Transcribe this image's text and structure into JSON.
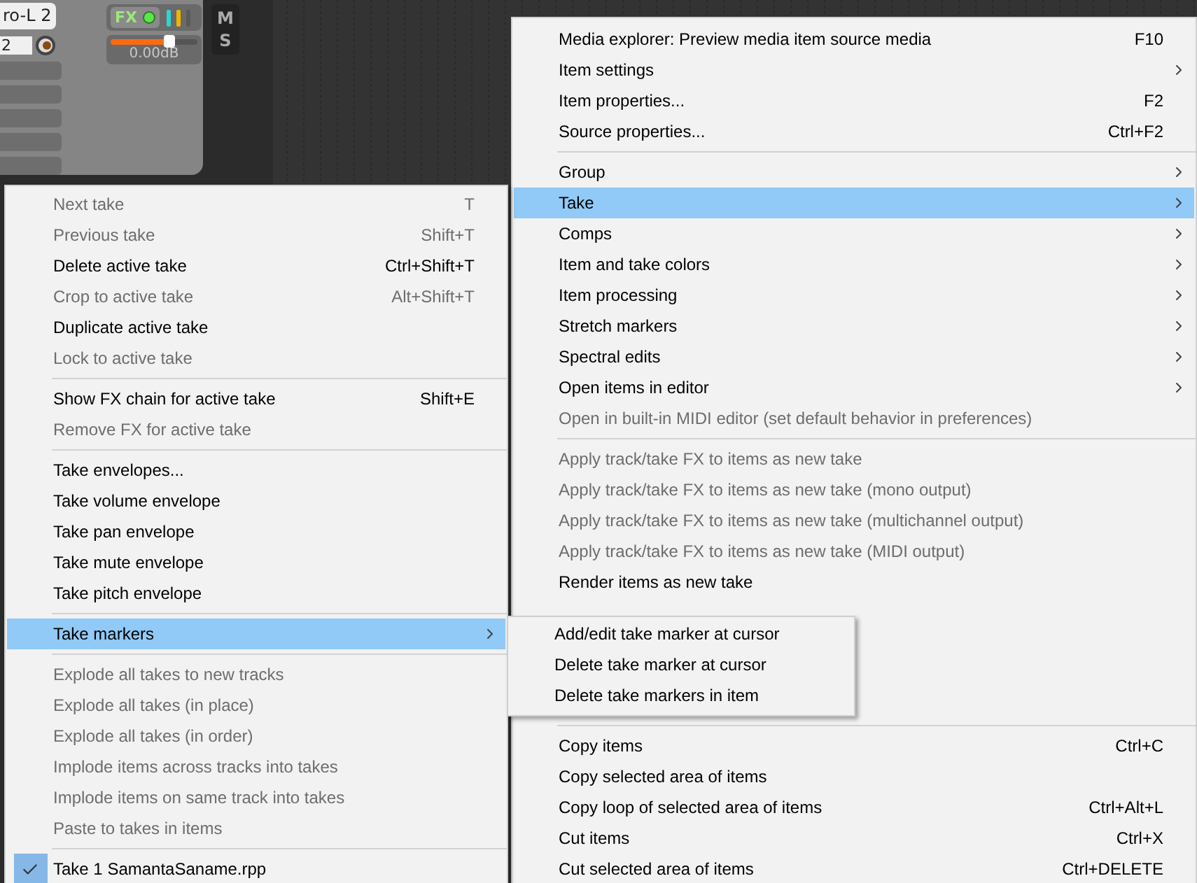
{
  "track_panel": {
    "name_field": "ro-L 2",
    "input_field": "2",
    "fx_button": "FX",
    "fader": {
      "level": 0.68,
      "reading": "0.00dB"
    },
    "mute_button": "M",
    "solo_button": "S"
  },
  "context_menu": {
    "items": [
      {
        "kind": "item",
        "label": "Media explorer: Preview media item source media",
        "shortcut": "F10",
        "disabled": false,
        "submenu": false,
        "selected": false
      },
      {
        "kind": "item",
        "label": "Item settings",
        "disabled": false,
        "submenu": true,
        "selected": false
      },
      {
        "kind": "item",
        "label": "Item properties...",
        "shortcut": "F2",
        "disabled": false,
        "submenu": false,
        "selected": false
      },
      {
        "kind": "item",
        "label": "Source properties...",
        "shortcut": "Ctrl+F2",
        "disabled": false,
        "submenu": false,
        "selected": false
      },
      {
        "kind": "separator"
      },
      {
        "kind": "item",
        "label": "Group",
        "disabled": false,
        "submenu": true,
        "selected": false
      },
      {
        "kind": "item",
        "label": "Take",
        "disabled": false,
        "submenu": true,
        "selected": true
      },
      {
        "kind": "item",
        "label": "Comps",
        "disabled": false,
        "submenu": true,
        "selected": false
      },
      {
        "kind": "item",
        "label": "Item and take colors",
        "disabled": false,
        "submenu": true,
        "selected": false
      },
      {
        "kind": "item",
        "label": "Item processing",
        "disabled": false,
        "submenu": true,
        "selected": false
      },
      {
        "kind": "item",
        "label": "Stretch markers",
        "disabled": false,
        "submenu": true,
        "selected": false
      },
      {
        "kind": "item",
        "label": "Spectral edits",
        "disabled": false,
        "submenu": true,
        "selected": false
      },
      {
        "kind": "item",
        "label": "Open items in editor",
        "disabled": false,
        "submenu": true,
        "selected": false
      },
      {
        "kind": "item",
        "label": "Open in built-in MIDI editor (set default behavior in preferences)",
        "disabled": true,
        "submenu": false,
        "selected": false
      },
      {
        "kind": "separator"
      },
      {
        "kind": "item",
        "label": "Apply track/take FX to items as new take",
        "disabled": true,
        "submenu": false,
        "selected": false
      },
      {
        "kind": "item",
        "label": "Apply track/take FX to items as new take (mono output)",
        "disabled": true,
        "submenu": false,
        "selected": false
      },
      {
        "kind": "item",
        "label": "Apply track/take FX to items as new take (multichannel output)",
        "disabled": true,
        "submenu": false,
        "selected": false
      },
      {
        "kind": "item",
        "label": "Apply track/take FX to items as new take (MIDI output)",
        "disabled": true,
        "submenu": false,
        "selected": false
      },
      {
        "kind": "item",
        "label": "Render items as new take",
        "disabled": false,
        "submenu": false,
        "selected": false
      },
      {
        "kind": "covered"
      },
      {
        "kind": "covered"
      },
      {
        "kind": "covered"
      },
      {
        "kind": "covered"
      },
      {
        "kind": "separator"
      },
      {
        "kind": "item",
        "label": "Copy items",
        "shortcut": "Ctrl+C",
        "disabled": false,
        "submenu": false,
        "selected": false
      },
      {
        "kind": "item",
        "label": "Copy selected area of items",
        "disabled": false,
        "submenu": false,
        "selected": false
      },
      {
        "kind": "item",
        "label": "Copy loop of selected area of items",
        "shortcut": "Ctrl+Alt+L",
        "disabled": false,
        "submenu": false,
        "selected": false
      },
      {
        "kind": "item",
        "label": "Cut items",
        "shortcut": "Ctrl+X",
        "disabled": false,
        "submenu": false,
        "selected": false
      },
      {
        "kind": "item",
        "label": "Cut selected area of items",
        "shortcut": "Ctrl+DELETE",
        "disabled": false,
        "submenu": false,
        "selected": false
      }
    ]
  },
  "take_submenu": {
    "items": [
      {
        "kind": "item",
        "label": "Next take",
        "shortcut": "T",
        "disabled": true,
        "submenu": false,
        "selected": false,
        "checked": false
      },
      {
        "kind": "item",
        "label": "Previous take",
        "shortcut": "Shift+T",
        "disabled": true,
        "submenu": false,
        "selected": false,
        "checked": false
      },
      {
        "kind": "item",
        "label": "Delete active take",
        "shortcut": "Ctrl+Shift+T",
        "disabled": false,
        "submenu": false,
        "selected": false,
        "checked": false
      },
      {
        "kind": "item",
        "label": "Crop to active take",
        "shortcut": "Alt+Shift+T",
        "disabled": true,
        "submenu": false,
        "selected": false,
        "checked": false
      },
      {
        "kind": "item",
        "label": "Duplicate active take",
        "disabled": false,
        "submenu": false,
        "selected": false,
        "checked": false
      },
      {
        "kind": "item",
        "label": "Lock to active take",
        "disabled": true,
        "submenu": false,
        "selected": false,
        "checked": false
      },
      {
        "kind": "separator"
      },
      {
        "kind": "item",
        "label": "Show FX chain for active take",
        "shortcut": "Shift+E",
        "disabled": false,
        "submenu": false,
        "selected": false,
        "checked": false
      },
      {
        "kind": "item",
        "label": "Remove FX for active take",
        "disabled": true,
        "submenu": false,
        "selected": false,
        "checked": false
      },
      {
        "kind": "separator"
      },
      {
        "kind": "item",
        "label": "Take envelopes...",
        "disabled": false,
        "submenu": false,
        "selected": false,
        "checked": false
      },
      {
        "kind": "item",
        "label": "Take volume envelope",
        "disabled": false,
        "submenu": false,
        "selected": false,
        "checked": false
      },
      {
        "kind": "item",
        "label": "Take pan envelope",
        "disabled": false,
        "submenu": false,
        "selected": false,
        "checked": false
      },
      {
        "kind": "item",
        "label": "Take mute envelope",
        "disabled": false,
        "submenu": false,
        "selected": false,
        "checked": false
      },
      {
        "kind": "item",
        "label": "Take pitch envelope",
        "disabled": false,
        "submenu": false,
        "selected": false,
        "checked": false
      },
      {
        "kind": "separator"
      },
      {
        "kind": "item",
        "label": "Take markers",
        "disabled": false,
        "submenu": true,
        "selected": true,
        "checked": false
      },
      {
        "kind": "separator"
      },
      {
        "kind": "item",
        "label": "Explode all takes to new tracks",
        "disabled": true,
        "submenu": false,
        "selected": false,
        "checked": false
      },
      {
        "kind": "item",
        "label": "Explode all takes (in place)",
        "disabled": true,
        "submenu": false,
        "selected": false,
        "checked": false
      },
      {
        "kind": "item",
        "label": "Explode all takes (in order)",
        "disabled": true,
        "submenu": false,
        "selected": false,
        "checked": false
      },
      {
        "kind": "item",
        "label": "Implode items across tracks into takes",
        "disabled": true,
        "submenu": false,
        "selected": false,
        "checked": false
      },
      {
        "kind": "item",
        "label": "Implode items on same track into takes",
        "disabled": true,
        "submenu": false,
        "selected": false,
        "checked": false
      },
      {
        "kind": "item",
        "label": "Paste to takes in items",
        "disabled": true,
        "submenu": false,
        "selected": false,
        "checked": false
      },
      {
        "kind": "separator"
      },
      {
        "kind": "item",
        "label": "Take 1 SamantaSaname.rpp",
        "disabled": false,
        "submenu": false,
        "selected": false,
        "checked": true
      }
    ]
  },
  "markers_submenu": {
    "items": [
      {
        "kind": "item",
        "label": "Add/edit take marker at cursor",
        "disabled": false,
        "submenu": false,
        "selected": false
      },
      {
        "kind": "item",
        "label": "Delete take marker at cursor",
        "disabled": false,
        "submenu": false,
        "selected": false
      },
      {
        "kind": "item",
        "label": "Delete take markers in item",
        "disabled": false,
        "submenu": false,
        "selected": false
      }
    ]
  }
}
